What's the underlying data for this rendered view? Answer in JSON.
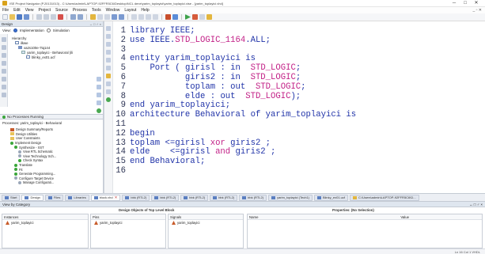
{
  "window": {
    "title": "ISE Project Navigator (P.20131013) - C:\\Users\\admin\\LAPTOP-92FFR5C6\\Desktop\\NCL dene\\yarim_toplayici\\yarim_toplayici.xise - [yarim_toplayici.vhd]",
    "controls": {
      "minimize": "─",
      "maximize": "□",
      "close": "✕"
    }
  },
  "menu": {
    "items": [
      "File",
      "Edit",
      "View",
      "Project",
      "Source",
      "Process",
      "Tools",
      "Window",
      "Layout",
      "Help"
    ],
    "right_controls": "_ ▫ ✕"
  },
  "design_panel": {
    "header": "Design",
    "header_controls": "↔ □ ♂ ×",
    "view_label": "View:",
    "view_options": [
      "Implementation",
      "Simulation"
    ],
    "hierarchy_label": "Hierarchy",
    "hierarchy": [
      {
        "label": "ilkwe",
        "icon": "project-icon"
      },
      {
        "label": "xa2s100e-7tq144",
        "icon": "chip-icon"
      },
      {
        "label": "yarim_toplayici - Behavioral (ili",
        "icon": "vhdl-file-icon"
      },
      {
        "label": "blinky_ex01.ucf",
        "icon": "ucf-file-icon"
      }
    ],
    "processes_status": "No Processes Running",
    "processes_title": "Processes: yarim_toplayici - Behavioral",
    "processes": [
      {
        "label": "Design Summary/Reports",
        "level": 1
      },
      {
        "label": "Design Utilities",
        "level": 1
      },
      {
        "label": "User Constraints",
        "level": 1
      },
      {
        "label": "Implement Design",
        "level": 1
      },
      {
        "label": "Synthesize - XST",
        "level": 1
      },
      {
        "label": "View RTL Schematic",
        "level": 2
      },
      {
        "label": "View Technology Sch...",
        "level": 2
      },
      {
        "label": "Check Syntax",
        "level": 2
      },
      {
        "label": "Translate",
        "level": 1
      },
      {
        "label": "Fit",
        "level": 1
      },
      {
        "label": "Generate Programming...",
        "level": 1
      },
      {
        "label": "Configure Target Device",
        "level": 1
      },
      {
        "label": "Manage Configurati...",
        "level": 2
      }
    ]
  },
  "editor": {
    "lines": [
      {
        "n": "1",
        "parts": [
          [
            "kw",
            "library "
          ],
          [
            "plain",
            "IEEE;"
          ]
        ]
      },
      {
        "n": "2",
        "parts": [
          [
            "kw",
            "use "
          ],
          [
            "plain",
            "IEEE."
          ],
          [
            "ty",
            "STD_LOGIC_1164"
          ],
          [
            "plain",
            ".ALL;"
          ]
        ]
      },
      {
        "n": "3",
        "parts": []
      },
      {
        "n": "4",
        "parts": [
          [
            "kw",
            "entity "
          ],
          [
            "plain",
            "yarim_toplayici "
          ],
          [
            "kw",
            "is"
          ]
        ]
      },
      {
        "n": "5",
        "parts": [
          [
            "plain",
            "    "
          ],
          [
            "kw",
            "Port "
          ],
          [
            "plain",
            "( girisl : "
          ],
          [
            "kw",
            "in  "
          ],
          [
            "ty",
            "STD_LOGIC"
          ],
          [
            "plain",
            ";"
          ]
        ]
      },
      {
        "n": "6",
        "parts": [
          [
            "plain",
            "           giris2 : "
          ],
          [
            "kw",
            "in  "
          ],
          [
            "ty",
            "STD_LOGIC"
          ],
          [
            "plain",
            ";"
          ]
        ]
      },
      {
        "n": "7",
        "parts": [
          [
            "plain",
            "           toplam : "
          ],
          [
            "kw",
            "out  "
          ],
          [
            "ty",
            "STD_LOGIC"
          ],
          [
            "plain",
            ";"
          ]
        ]
      },
      {
        "n": "8",
        "parts": [
          [
            "plain",
            "           elde : "
          ],
          [
            "kw",
            "out  "
          ],
          [
            "ty",
            "STD_LOGIC"
          ],
          [
            "plain",
            ");"
          ]
        ]
      },
      {
        "n": "9",
        "parts": [
          [
            "kw",
            "end "
          ],
          [
            "plain",
            "yarim_toplayici;"
          ]
        ]
      },
      {
        "n": "10",
        "parts": [
          [
            "kw",
            "architecture "
          ],
          [
            "plain",
            "Behavioral "
          ],
          [
            "kw",
            "of "
          ],
          [
            "plain",
            "yarim_toplayici "
          ],
          [
            "kw",
            "is"
          ]
        ]
      },
      {
        "n": "11",
        "parts": []
      },
      {
        "n": "12",
        "parts": [
          [
            "kw",
            "begin"
          ]
        ]
      },
      {
        "n": "13",
        "parts": [
          [
            "plain",
            "toplam <=girisl "
          ],
          [
            "ty",
            "xor "
          ],
          [
            "plain",
            "giris2 ;"
          ]
        ]
      },
      {
        "n": "14",
        "parts": [
          [
            "plain",
            "elde    <=girisl "
          ],
          [
            "ty",
            "and "
          ],
          [
            "plain",
            "giris2 ;"
          ]
        ]
      },
      {
        "n": "15",
        "parts": [
          [
            "kw",
            "end "
          ],
          [
            "plain",
            "Behavioral;"
          ]
        ]
      },
      {
        "n": "16",
        "parts": []
      }
    ]
  },
  "tabs": {
    "panel_tabs": [
      "Start",
      "Design",
      "Files",
      "Libraries"
    ],
    "editor_tabs": [
      "block.vhd",
      "bbk (RTL2)",
      "bbk (RTL2)",
      "bbk (RTL2)",
      "bbk (RTL2)",
      "bbk (RTL2)",
      "yarim_toplayici (Tech1)",
      "Blinky_ex01.ucf",
      "C:\\Users\\admin\\LAPTOP-92FFR5C6\\D..."
    ]
  },
  "design_objects": {
    "header": "Design Objects of Top Level Block",
    "view_by": "View by Category",
    "header_controls": "↔ □ ♂ ×",
    "instances_label": "Instances",
    "instances": [
      "yarim_toplayici"
    ],
    "pins_label": "Pins",
    "pins": [
      "yarim_toplayici"
    ],
    "signals_label": "Signals",
    "signals": [
      "yarim_toplayici"
    ],
    "properties_title": "Properties: (No Selection)",
    "properties_cols": [
      "Name",
      "Value"
    ]
  },
  "status": {
    "text": "Ln 16 Col 1   VHDL"
  },
  "colors": {
    "keyword": "#2033a8",
    "type": "#c21f86",
    "panel_header": "#dfe6ef"
  }
}
